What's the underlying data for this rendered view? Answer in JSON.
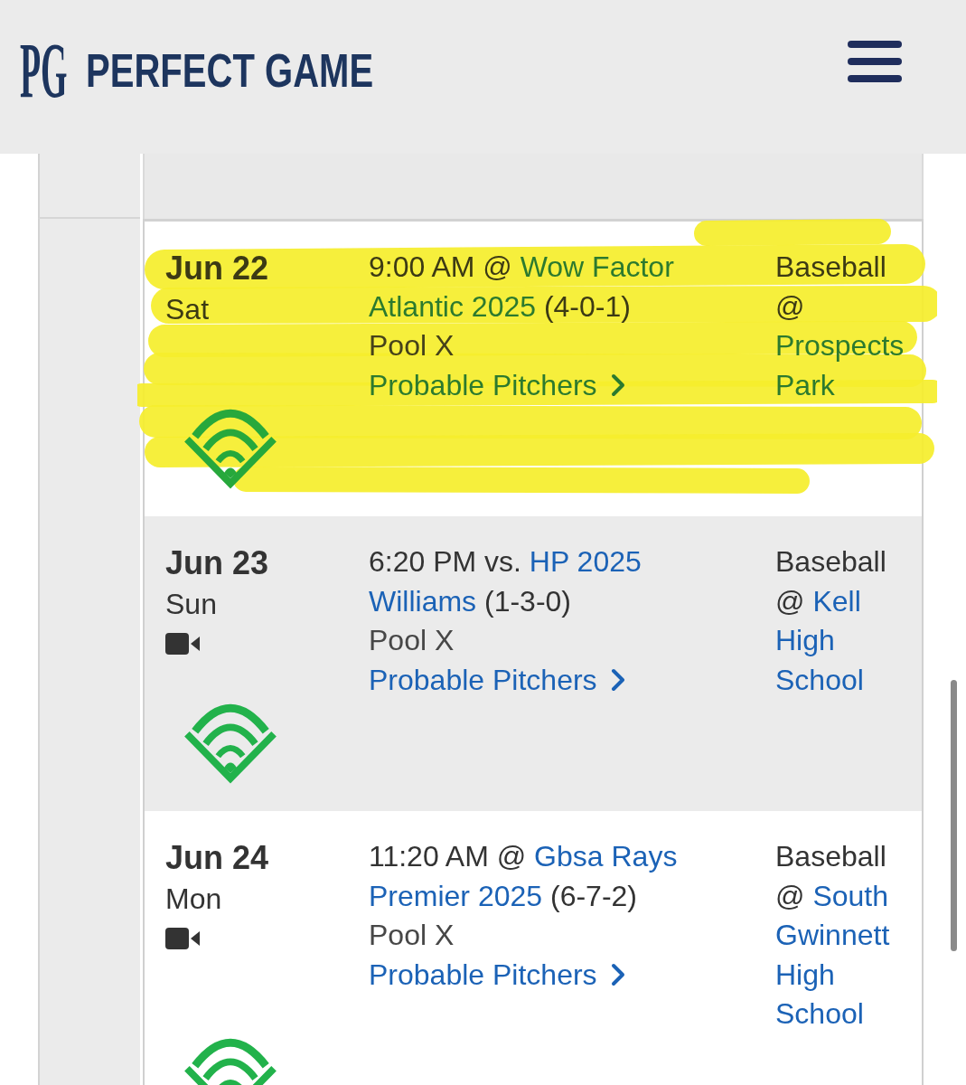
{
  "header": {
    "logo_mark": "PG",
    "brand": "PERFECT GAME"
  },
  "games": [
    {
      "date": "Jun 22",
      "weekday": "Sat",
      "video": false,
      "highlighted": true,
      "time": "9:00 AM",
      "relation": "@",
      "opponent": [
        "Wow Factor",
        "Atlantic 2025"
      ],
      "record": "(4-0-1)",
      "pool": "Pool X",
      "pitchers_link": "Probable Pitchers",
      "sport": "Baseball",
      "venue_prefix": "@",
      "venue": [
        "Prospects",
        "Park"
      ]
    },
    {
      "date": "Jun 23",
      "weekday": "Sun",
      "video": true,
      "highlighted": false,
      "time": "6:20 PM",
      "relation": "vs.",
      "opponent": [
        "HP 2025",
        "Williams"
      ],
      "record": "(1-3-0)",
      "pool": "Pool X",
      "pitchers_link": "Probable Pitchers",
      "sport": "Baseball",
      "venue_prefix": "@",
      "venue": [
        "Kell",
        "High",
        "School"
      ]
    },
    {
      "date": "Jun 24",
      "weekday": "Mon",
      "video": true,
      "highlighted": false,
      "time": "11:20 AM",
      "relation": "@",
      "opponent": [
        "Gbsa Rays",
        "Premier 2025"
      ],
      "record": "(6-7-2)",
      "pool": "Pool X",
      "pitchers_link": "Probable Pitchers",
      "sport": "Baseball",
      "venue_prefix": "@",
      "venue": [
        "South",
        "Gwinnett",
        "High",
        "School"
      ]
    }
  ]
}
